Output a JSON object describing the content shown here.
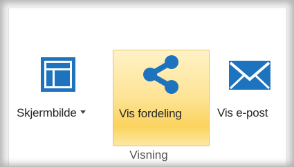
{
  "ribbon": {
    "group_label": "Visning",
    "buttons": [
      {
        "label": "Skjermbilde",
        "icon": "screenshot-layout-icon",
        "has_dropdown": true,
        "selected": false
      },
      {
        "label": "Vis fordeling",
        "icon": "share-icon",
        "has_dropdown": false,
        "selected": true
      },
      {
        "label": "Vis e-post",
        "icon": "envelope-icon",
        "has_dropdown": false,
        "selected": false
      }
    ]
  },
  "colors": {
    "icon_blue": "#1e73be",
    "selected_gradient_top": "#fff2c6",
    "selected_gradient_bottom": "#fbd35e",
    "selected_border": "#e8c36a"
  }
}
